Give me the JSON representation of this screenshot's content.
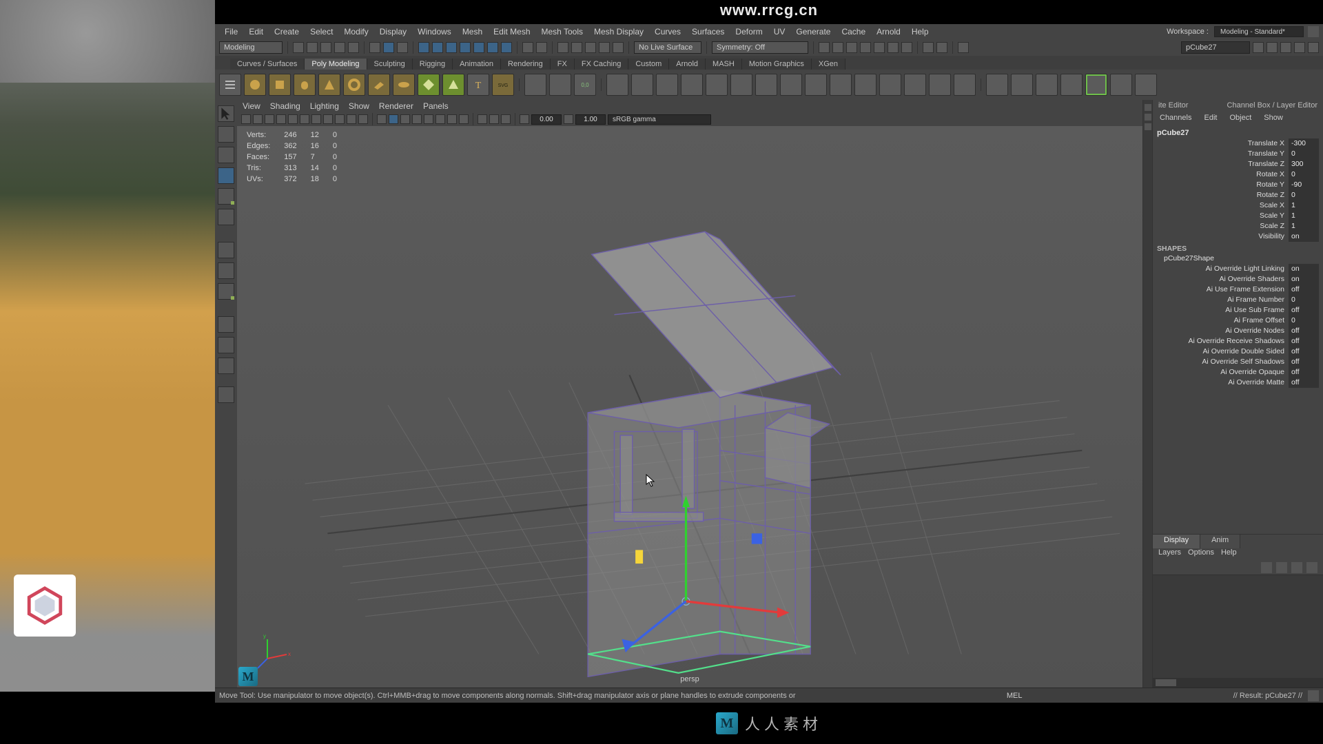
{
  "top_url": "www.rrcg.cn",
  "menu": {
    "items": [
      "File",
      "Edit",
      "Create",
      "Select",
      "Modify",
      "Display",
      "Windows",
      "Mesh",
      "Edit Mesh",
      "Mesh Tools",
      "Mesh Display",
      "Curves",
      "Surfaces",
      "Deform",
      "UV",
      "Generate",
      "Cache",
      "Arnold",
      "Help"
    ]
  },
  "workspace": {
    "label": "Workspace :",
    "value": "Modeling - Standard*"
  },
  "mode_dropdown": "Modeling",
  "no_live": "No Live Surface",
  "symmetry": "Symmetry: Off",
  "object_field": "pCube27",
  "shelf": {
    "tabs": [
      "Curves / Surfaces",
      "Poly Modeling",
      "Sculpting",
      "Rigging",
      "Animation",
      "Rendering",
      "FX",
      "FX Caching",
      "Custom",
      "Arnold",
      "MASH",
      "Motion Graphics",
      "XGen"
    ],
    "active": "Poly Modeling"
  },
  "viewport_menus": [
    "View",
    "Shading",
    "Lighting",
    "Show",
    "Renderer",
    "Panels"
  ],
  "exposure": "0.00",
  "gamma": "1.00",
  "color_space": "sRGB gamma",
  "polystats": {
    "rows": [
      {
        "label": "Verts:",
        "a": "246",
        "b": "12",
        "c": "0"
      },
      {
        "label": "Edges:",
        "a": "362",
        "b": "16",
        "c": "0"
      },
      {
        "label": "Faces:",
        "a": "157",
        "b": "7",
        "c": "0"
      },
      {
        "label": "Tris:",
        "a": "313",
        "b": "14",
        "c": "0"
      },
      {
        "label": "UVs:",
        "a": "372",
        "b": "18",
        "c": "0"
      }
    ]
  },
  "camera_name": "persp",
  "right_panel": {
    "left_header": "ite Editor",
    "right_header": "Channel Box / Layer Editor",
    "tabs": [
      "Channels",
      "Edit",
      "Object",
      "Show"
    ],
    "object": "pCube27",
    "channels": [
      {
        "label": "Translate X",
        "value": "-300"
      },
      {
        "label": "Translate Y",
        "value": "0"
      },
      {
        "label": "Translate Z",
        "value": "300"
      },
      {
        "label": "Rotate X",
        "value": "0"
      },
      {
        "label": "Rotate Y",
        "value": "-90"
      },
      {
        "label": "Rotate Z",
        "value": "0"
      },
      {
        "label": "Scale X",
        "value": "1"
      },
      {
        "label": "Scale Y",
        "value": "1"
      },
      {
        "label": "Scale Z",
        "value": "1"
      },
      {
        "label": "Visibility",
        "value": "on"
      }
    ],
    "shapes_label": "SHAPES",
    "shape_name": "pCube27Shape",
    "shape_attrs": [
      {
        "label": "Ai Override Light Linking",
        "value": "on"
      },
      {
        "label": "Ai Override Shaders",
        "value": "on"
      },
      {
        "label": "Ai Use Frame Extension",
        "value": "off"
      },
      {
        "label": "Ai Frame Number",
        "value": "0"
      },
      {
        "label": "Ai Use Sub Frame",
        "value": "off"
      },
      {
        "label": "Ai Frame Offset",
        "value": "0"
      },
      {
        "label": "Ai Override Nodes",
        "value": "off"
      },
      {
        "label": "Ai Override Receive Shadows",
        "value": "off"
      },
      {
        "label": "Ai Override Double Sided",
        "value": "off"
      },
      {
        "label": "Ai Override Self Shadows",
        "value": "off"
      },
      {
        "label": "Ai Override Opaque",
        "value": "off"
      },
      {
        "label": "Ai Override Matte",
        "value": "off"
      }
    ],
    "layer_tabs": [
      "Display",
      "Anim"
    ],
    "layer_menu": [
      "Layers",
      "Options",
      "Help"
    ]
  },
  "helpline": "Move Tool: Use manipulator to move object(s). Ctrl+MMB+drag to move components along normals. Shift+drag manipulator axis or plane handles to extrude components or",
  "script_lang": "MEL",
  "result_line": "// Result: pCube27 //",
  "bottom_text": "人人素材"
}
